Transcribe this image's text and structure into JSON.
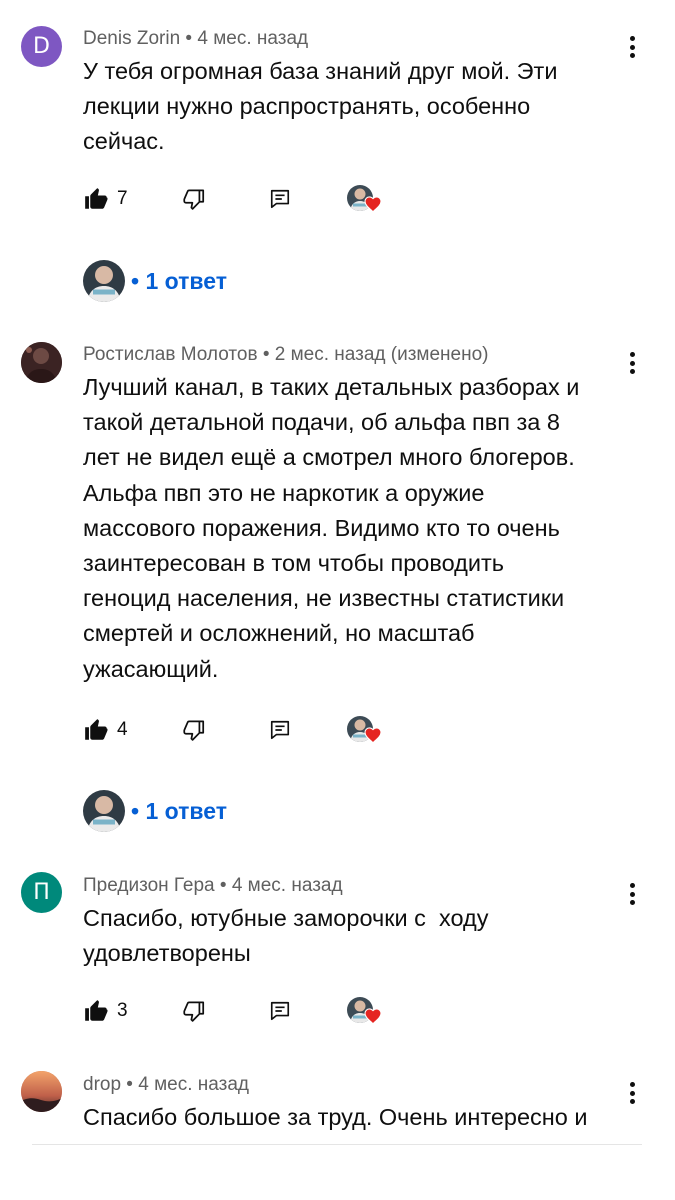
{
  "comments": [
    {
      "avatar_letter": "D",
      "avatar_color": "#7e57c2",
      "author": "Denis Zorin",
      "time": "4 мес. назад",
      "meta": "Denis Zorin • 4 мес. назад",
      "text": "У тебя огромная база знаний друг мой. Эти\nлекции нужно распространять, особенно\nсейчас.",
      "likes": "7",
      "hearted": true,
      "replies_label": "• 1 ответ"
    },
    {
      "avatar_letter": "",
      "avatar_color": "#5a3a3a",
      "author": "Ростислав Молотов",
      "time": "2 мес. назад (изменено)",
      "meta": "Ростислав Молотов • 2 мес. назад (изменено)",
      "text": "Лучший канал, в таких детальных разборах и\nтакой детальной подачи, об альфа пвп за 8\nлет не видел ещё а смотрел много блогеров.\nАльфа пвп это не наркотик а оружие\nмассового поражения. Видимо кто то очень\nзаинтересован в том чтобы проводить\nгеноцид населения, не известны статистики\nсмертей и осложнений, но масштаб\nужасающий.",
      "likes": "4",
      "hearted": true,
      "replies_label": "• 1 ответ"
    },
    {
      "avatar_letter": "П",
      "avatar_color": "#00897b",
      "author": "Предизон Гера",
      "time": "4 мес. назад",
      "meta": "Предизон Гера • 4 мес. назад",
      "text": "Спасибо, ютубные заморочки с  ходу\nудовлетворены",
      "likes": "3",
      "hearted": true
    },
    {
      "avatar_letter": "",
      "avatar_color": "#b86a4a",
      "author": "drop",
      "time": "4 мес. назад",
      "meta": "drop • 4 мес. назад",
      "text": "Спасибо большое за труд. Очень интересно и"
    }
  ],
  "icons": {
    "like": "thumb-up-icon",
    "dislike": "thumb-down-icon",
    "reply": "reply-icon",
    "more": "more-vert-icon",
    "heart": "heart-icon"
  },
  "colors": {
    "link": "#065fd4",
    "heart": "#e52521",
    "meta": "#606060"
  }
}
